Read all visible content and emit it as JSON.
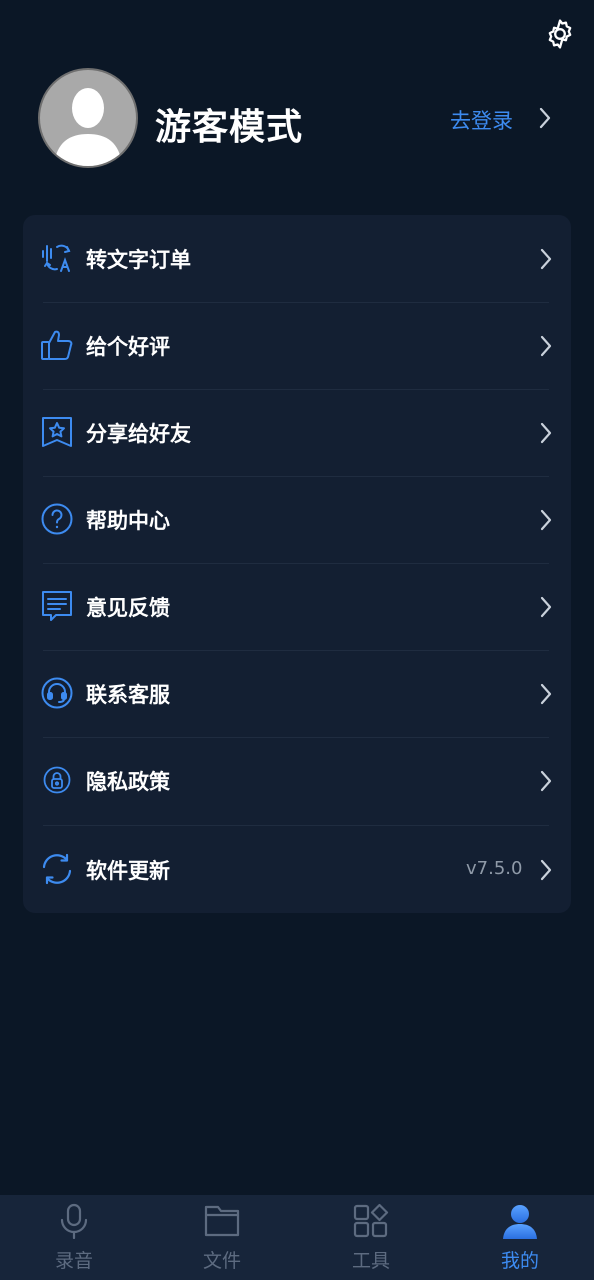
{
  "header": {
    "settings_icon": "gear-icon"
  },
  "profile": {
    "username": "游客模式",
    "login_label": "去登录",
    "avatar_icon": "default-avatar-icon"
  },
  "menu": {
    "items": [
      {
        "label": "转文字订单",
        "icon": "audio-translate-icon",
        "value": ""
      },
      {
        "label": "给个好评",
        "icon": "thumbs-up-icon",
        "value": ""
      },
      {
        "label": "分享给好友",
        "icon": "share-star-icon",
        "value": ""
      },
      {
        "label": "帮助中心",
        "icon": "help-circle-icon",
        "value": ""
      },
      {
        "label": "意见反馈",
        "icon": "feedback-message-icon",
        "value": ""
      },
      {
        "label": "联系客服",
        "icon": "headset-icon",
        "value": ""
      },
      {
        "label": "隐私政策",
        "icon": "privacy-lock-icon",
        "value": ""
      },
      {
        "label": "软件更新",
        "icon": "refresh-icon",
        "value": "v7.5.0"
      }
    ]
  },
  "tabbar": {
    "tabs": [
      {
        "label": "录音",
        "icon": "microphone-icon",
        "active": false
      },
      {
        "label": "文件",
        "icon": "folder-icon",
        "active": false
      },
      {
        "label": "工具",
        "icon": "tools-grid-icon",
        "active": false
      },
      {
        "label": "我的",
        "icon": "user-icon",
        "active": true
      }
    ]
  },
  "colors": {
    "background": "#0b1726",
    "card": "#131f32",
    "accent": "#3d8bf0",
    "muted": "#5d6b80"
  }
}
